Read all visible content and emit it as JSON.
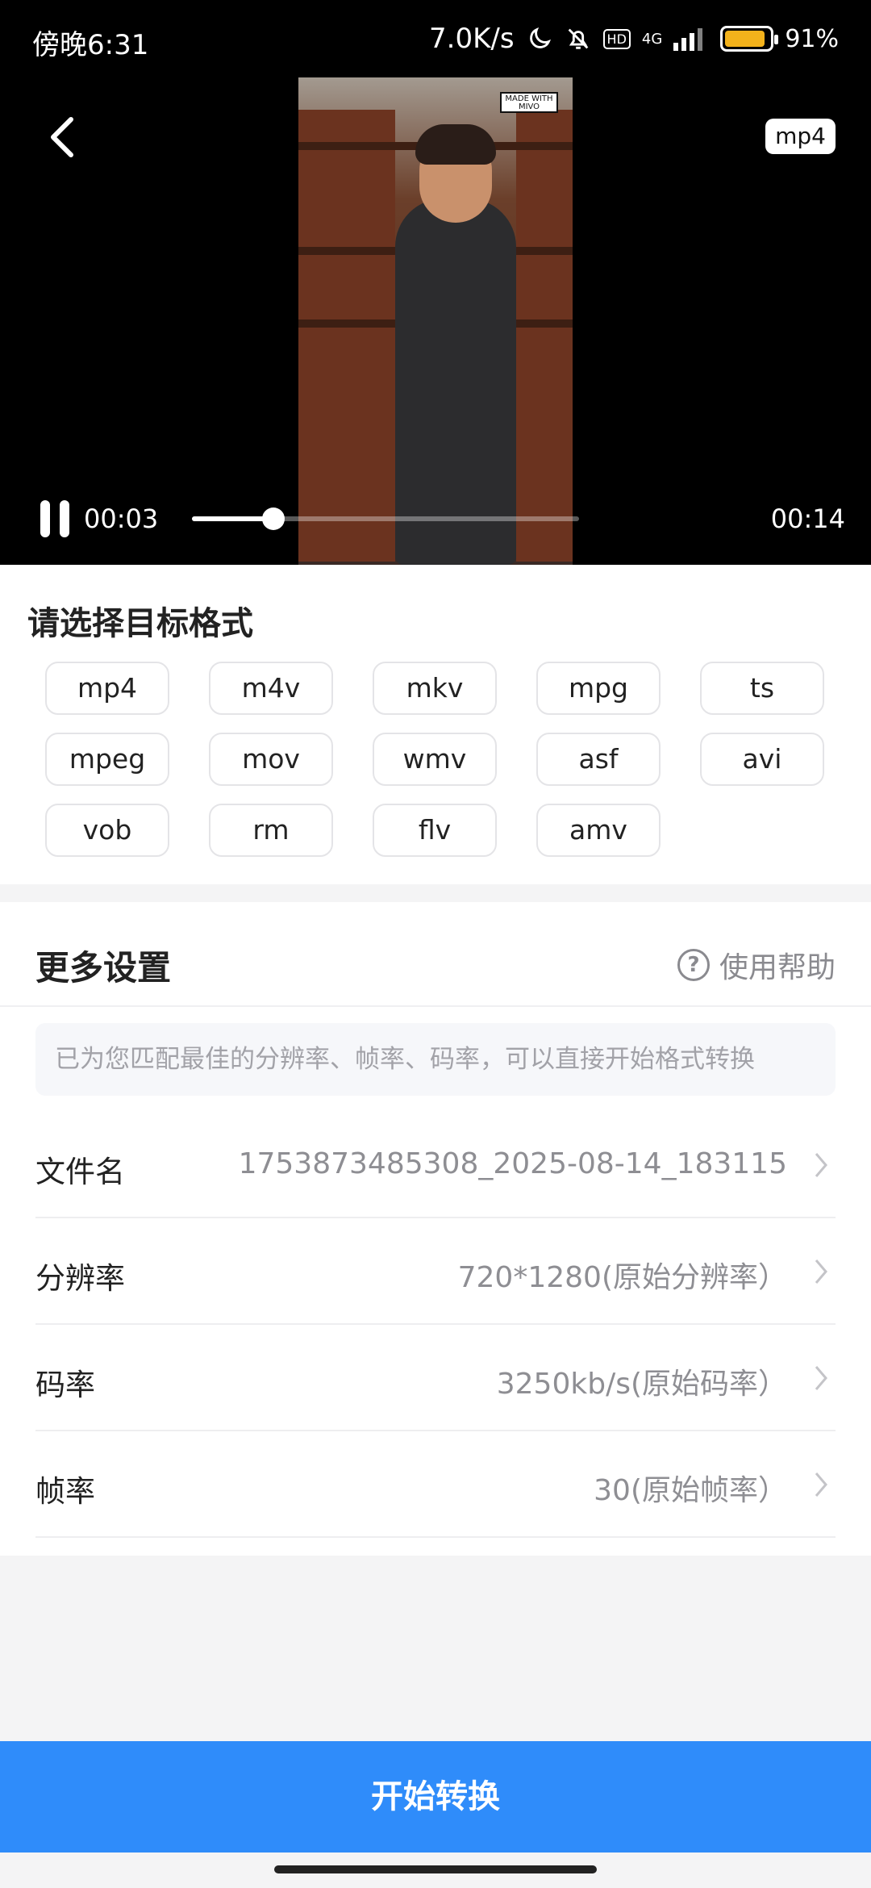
{
  "status_bar": {
    "time": "傍晚6:31",
    "speed": "7.0K/s",
    "network": "4G",
    "hd": "HD",
    "battery": "91%",
    "battery_level": 0.91
  },
  "player": {
    "format_badge": "mp4",
    "current_time": "00:03",
    "total_time": "00:14",
    "progress": 0.21,
    "watermark": "MADE WITH MIVO"
  },
  "formats": {
    "title": "请选择目标格式",
    "items": [
      "mp4",
      "m4v",
      "mkv",
      "mpg",
      "ts",
      "mpeg",
      "mov",
      "wmv",
      "asf",
      "avi",
      "vob",
      "rm",
      "flv",
      "amv"
    ]
  },
  "settings": {
    "title": "更多设置",
    "help_label": "使用帮助",
    "tip": "已为您匹配最佳的分辨率、帧率、码率，可以直接开始格式转换",
    "rows": [
      {
        "label": "文件名",
        "value": "1753873485308_2025-08-14_183115"
      },
      {
        "label": "分辨率",
        "value": "720*1280(原始分辨率）"
      },
      {
        "label": "码率",
        "value": "3250kb/s(原始码率）"
      },
      {
        "label": "帧率",
        "value": "30(原始帧率）"
      }
    ]
  },
  "action": {
    "start_label": "开始转换"
  },
  "colors": {
    "accent": "#2f8cfa",
    "battery": "#f3b21b"
  }
}
